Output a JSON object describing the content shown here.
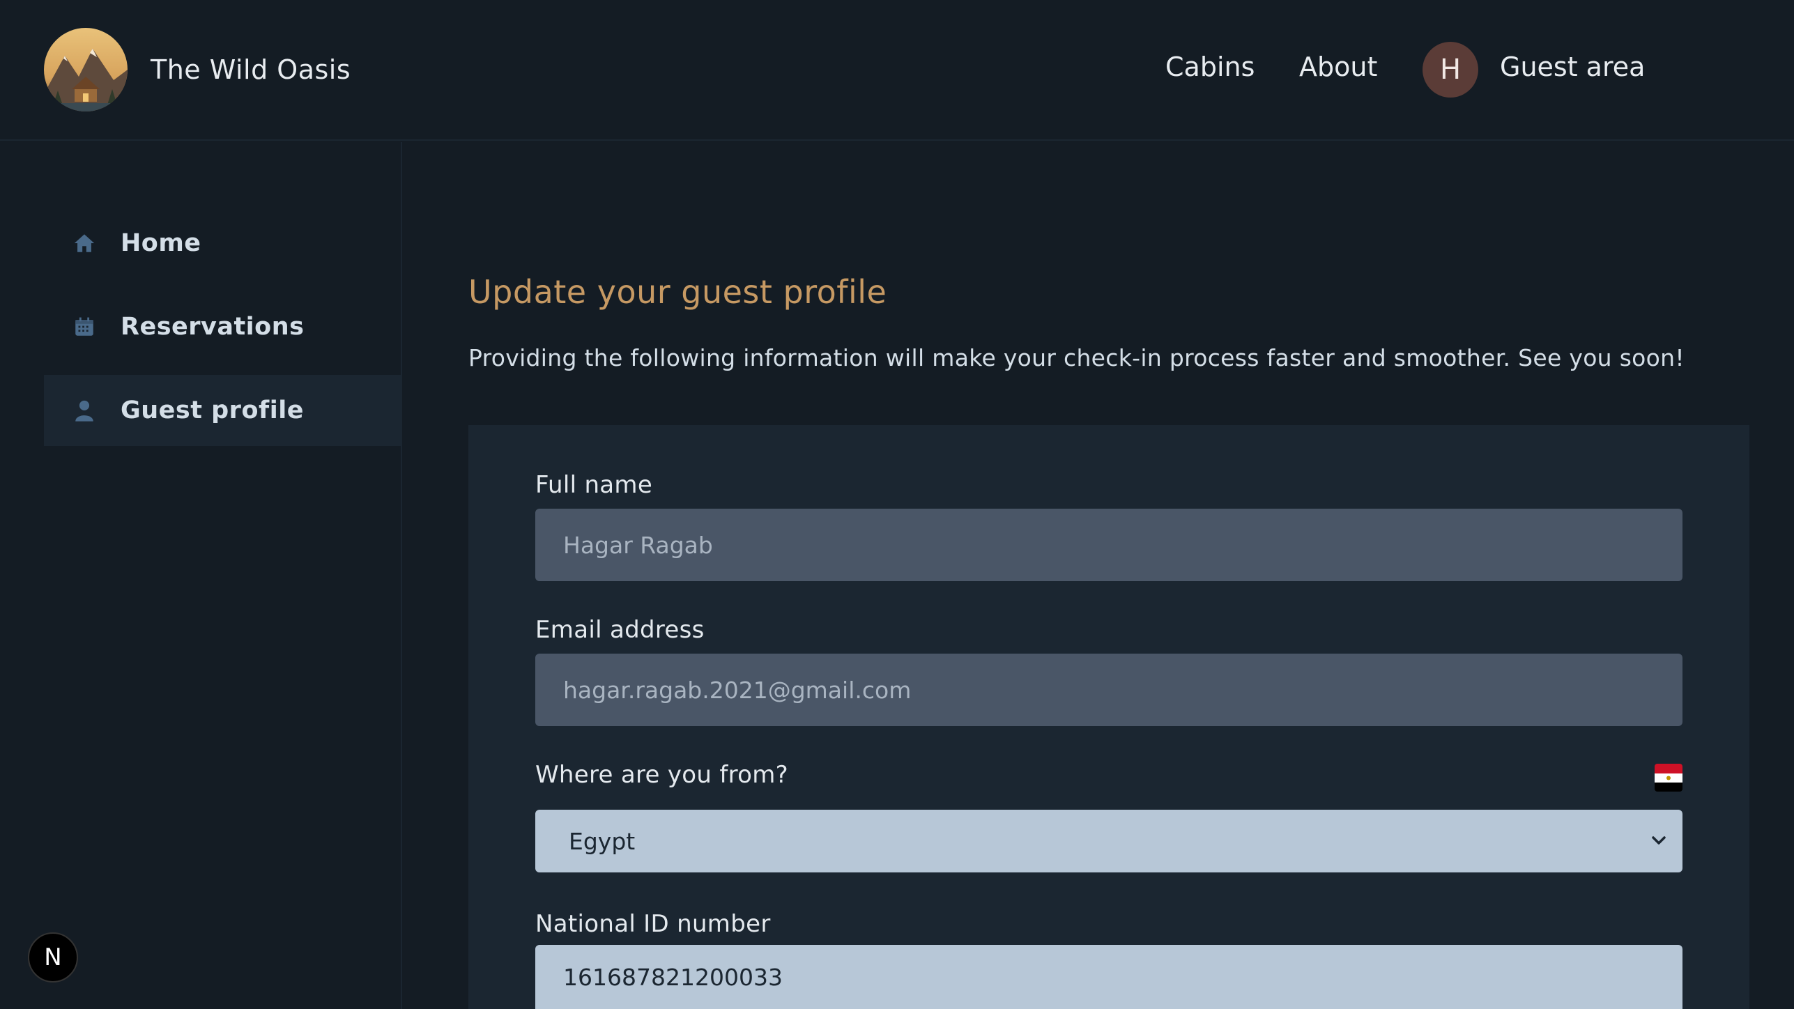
{
  "header": {
    "app_name": "The Wild Oasis",
    "nav": {
      "cabins": "Cabins",
      "about": "About",
      "guest_area": "Guest area"
    },
    "avatar_letter": "H"
  },
  "sidebar": {
    "items": [
      {
        "label": "Home",
        "icon": "home-icon",
        "active": false
      },
      {
        "label": "Reservations",
        "icon": "calendar-icon",
        "active": false
      },
      {
        "label": "Guest profile",
        "icon": "user-icon",
        "active": true
      }
    ]
  },
  "main": {
    "title": "Update your guest profile",
    "subtitle": "Providing the following information will make your check-in process faster and smoother. See you soon!"
  },
  "form": {
    "full_name_label": "Full name",
    "full_name_value": "Hagar Ragab",
    "email_label": "Email address",
    "email_value": "hagar.ragab.2021@gmail.com",
    "country_label": "Where are you from?",
    "country_value": "Egypt",
    "national_id_label": "National ID number",
    "national_id_value": "161687821200033"
  },
  "dev_badge": "N",
  "colors": {
    "background": "#141c24",
    "panel": "#1b2631",
    "accent": "#c69963",
    "input_disabled": "#4a5667",
    "input_light": "#b7c7d7",
    "avatar": "#5b3c37"
  }
}
